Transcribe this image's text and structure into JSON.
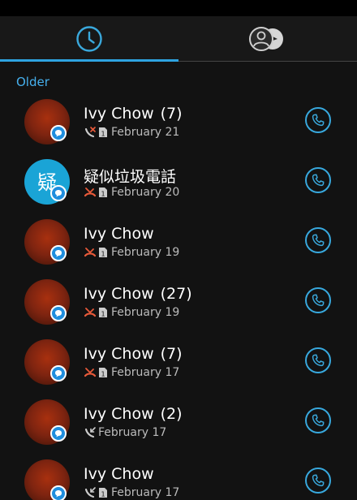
{
  "tabs": {
    "call_history_icon": "clock-icon",
    "contacts_icon": "contacts-icon",
    "active_tab": "call-history"
  },
  "section_label": "Older",
  "colors": {
    "accent": "#2ea3e0",
    "missed": "#e85a3a",
    "background": "#121212"
  },
  "calls": [
    {
      "name": "Ivy Chow",
      "count": "(7)",
      "date": "February 21",
      "call_type": "missed-incoming",
      "avatar": "photo",
      "has_sim_icon": true
    },
    {
      "name": "疑似垃圾電話",
      "count": "",
      "date": "February 20",
      "call_type": "missed",
      "avatar": "letter",
      "avatar_letter": "疑",
      "has_sim_icon": true
    },
    {
      "name": "Ivy Chow",
      "count": "",
      "date": "February 19",
      "call_type": "missed",
      "avatar": "photo",
      "has_sim_icon": true
    },
    {
      "name": "Ivy Chow",
      "count": "(27)",
      "date": "February 19",
      "call_type": "missed",
      "avatar": "photo",
      "has_sim_icon": true
    },
    {
      "name": "Ivy Chow",
      "count": "(7)",
      "date": "February 17",
      "call_type": "missed",
      "avatar": "photo",
      "has_sim_icon": true
    },
    {
      "name": "Ivy Chow",
      "count": "(2)",
      "date": "February 17",
      "call_type": "incoming",
      "avatar": "photo",
      "has_sim_icon": false
    },
    {
      "name": "Ivy Chow",
      "count": "",
      "date": "February 17",
      "call_type": "incoming",
      "avatar": "photo",
      "has_sim_icon": true
    }
  ]
}
